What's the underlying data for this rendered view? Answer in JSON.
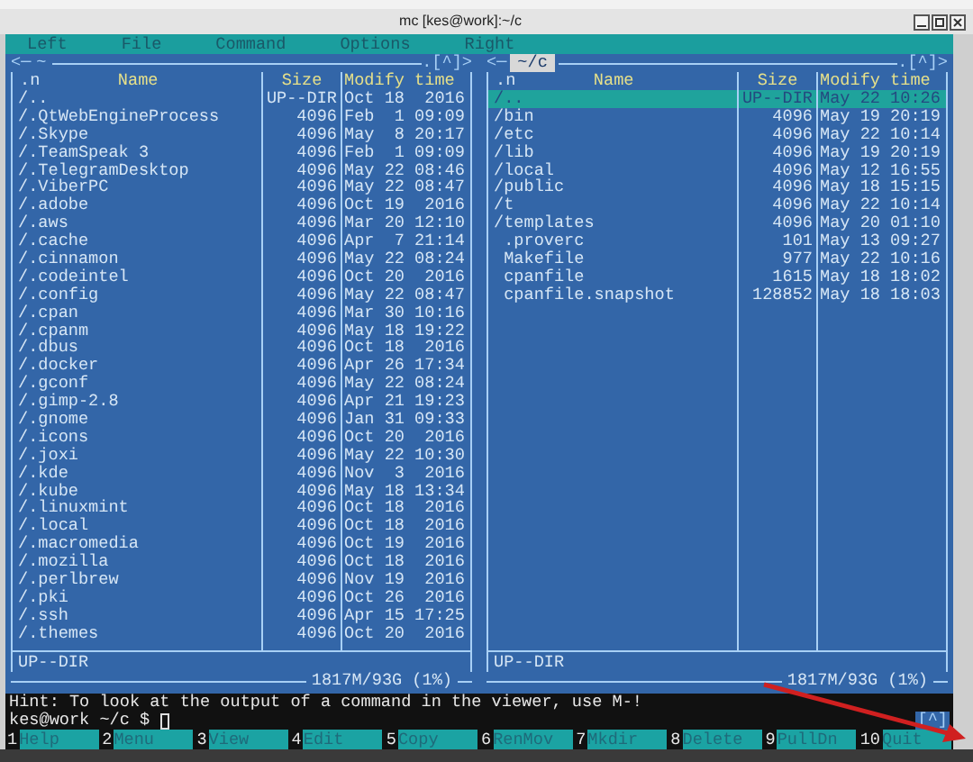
{
  "window": {
    "title": "mc [kes@work]:~/c"
  },
  "menu": [
    "Left",
    "File",
    "Command",
    "Options",
    "Right"
  ],
  "panels": [
    {
      "path": "~",
      "active": false,
      "left_marker": "<─",
      "right_marker": ".[^]>",
      "columns": {
        "sort": ".n",
        "name": "Name",
        "size": "Size",
        "time": "Modify time"
      },
      "files": [
        {
          "name": "/..",
          "size": "UP--DIR",
          "time": "Oct 18  2016",
          "selected": false
        },
        {
          "name": "/.QtWebEngineProcess",
          "size": "4096",
          "time": "Feb  1 09:09",
          "selected": false
        },
        {
          "name": "/.Skype",
          "size": "4096",
          "time": "May  8 20:17",
          "selected": false
        },
        {
          "name": "/.TeamSpeak 3",
          "size": "4096",
          "time": "Feb  1 09:09",
          "selected": false
        },
        {
          "name": "/.TelegramDesktop",
          "size": "4096",
          "time": "May 22 08:46",
          "selected": false
        },
        {
          "name": "/.ViberPC",
          "size": "4096",
          "time": "May 22 08:47",
          "selected": false
        },
        {
          "name": "/.adobe",
          "size": "4096",
          "time": "Oct 19  2016",
          "selected": false
        },
        {
          "name": "/.aws",
          "size": "4096",
          "time": "Mar 20 12:10",
          "selected": false
        },
        {
          "name": "/.cache",
          "size": "4096",
          "time": "Apr  7 21:14",
          "selected": false
        },
        {
          "name": "/.cinnamon",
          "size": "4096",
          "time": "May 22 08:24",
          "selected": false
        },
        {
          "name": "/.codeintel",
          "size": "4096",
          "time": "Oct 20  2016",
          "selected": false
        },
        {
          "name": "/.config",
          "size": "4096",
          "time": "May 22 08:47",
          "selected": false
        },
        {
          "name": "/.cpan",
          "size": "4096",
          "time": "Mar 30 10:16",
          "selected": false
        },
        {
          "name": "/.cpanm",
          "size": "4096",
          "time": "May 18 19:22",
          "selected": false
        },
        {
          "name": "/.dbus",
          "size": "4096",
          "time": "Oct 18  2016",
          "selected": false
        },
        {
          "name": "/.docker",
          "size": "4096",
          "time": "Apr 26 17:34",
          "selected": false
        },
        {
          "name": "/.gconf",
          "size": "4096",
          "time": "May 22 08:24",
          "selected": false
        },
        {
          "name": "/.gimp-2.8",
          "size": "4096",
          "time": "Apr 21 19:23",
          "selected": false
        },
        {
          "name": "/.gnome",
          "size": "4096",
          "time": "Jan 31 09:33",
          "selected": false
        },
        {
          "name": "/.icons",
          "size": "4096",
          "time": "Oct 20  2016",
          "selected": false
        },
        {
          "name": "/.joxi",
          "size": "4096",
          "time": "May 22 10:30",
          "selected": false
        },
        {
          "name": "/.kde",
          "size": "4096",
          "time": "Nov  3  2016",
          "selected": false
        },
        {
          "name": "/.kube",
          "size": "4096",
          "time": "May 18 13:34",
          "selected": false
        },
        {
          "name": "/.linuxmint",
          "size": "4096",
          "time": "Oct 18  2016",
          "selected": false
        },
        {
          "name": "/.local",
          "size": "4096",
          "time": "Oct 18  2016",
          "selected": false
        },
        {
          "name": "/.macromedia",
          "size": "4096",
          "time": "Oct 19  2016",
          "selected": false
        },
        {
          "name": "/.mozilla",
          "size": "4096",
          "time": "Oct 18  2016",
          "selected": false
        },
        {
          "name": "/.perlbrew",
          "size": "4096",
          "time": "Nov 19  2016",
          "selected": false
        },
        {
          "name": "/.pki",
          "size": "4096",
          "time": "Oct 26  2016",
          "selected": false
        },
        {
          "name": "/.ssh",
          "size": "4096",
          "time": "Apr 15 17:25",
          "selected": false
        },
        {
          "name": "/.themes",
          "size": "4096",
          "time": "Oct 20  2016",
          "selected": false
        }
      ],
      "mini_status": "UP--DIR",
      "disk": "1817M/93G (1%)"
    },
    {
      "path": "~/c",
      "active": true,
      "left_marker": "<─",
      "right_marker": ".[^]>",
      "columns": {
        "sort": ".n",
        "name": "Name",
        "size": "Size",
        "time": "Modify time"
      },
      "files": [
        {
          "name": "/..",
          "size": "UP--DIR",
          "time": "May 22 10:26",
          "selected": true
        },
        {
          "name": "/bin",
          "size": "4096",
          "time": "May 19 20:19",
          "selected": false
        },
        {
          "name": "/etc",
          "size": "4096",
          "time": "May 22 10:14",
          "selected": false
        },
        {
          "name": "/lib",
          "size": "4096",
          "time": "May 19 20:19",
          "selected": false
        },
        {
          "name": "/local",
          "size": "4096",
          "time": "May 12 16:55",
          "selected": false
        },
        {
          "name": "/public",
          "size": "4096",
          "time": "May 18 15:15",
          "selected": false
        },
        {
          "name": "/t",
          "size": "4096",
          "time": "May 22 10:14",
          "selected": false
        },
        {
          "name": "/templates",
          "size": "4096",
          "time": "May 20 01:10",
          "selected": false
        },
        {
          "name": " .proverc",
          "size": "101",
          "time": "May 13 09:27",
          "selected": false
        },
        {
          "name": " Makefile",
          "size": "977",
          "time": "May 22 10:16",
          "selected": false
        },
        {
          "name": " cpanfile",
          "size": "1615",
          "time": "May 18 18:02",
          "selected": false
        },
        {
          "name": " cpanfile.snapshot",
          "size": "128852",
          "time": "May 18 18:03",
          "selected": false
        }
      ],
      "mini_status": "UP--DIR",
      "disk": "1817M/93G (1%)"
    }
  ],
  "hint": "Hint: To look at the output of a command in the viewer, use M-!",
  "prompt": "kes@work ~/c $",
  "shell_indicator": "[^]",
  "function_keys": [
    {
      "number": "1",
      "label": "Help"
    },
    {
      "number": "2",
      "label": "Menu"
    },
    {
      "number": "3",
      "label": "View"
    },
    {
      "number": "4",
      "label": "Edit"
    },
    {
      "number": "5",
      "label": "Copy"
    },
    {
      "number": "6",
      "label": "RenMov"
    },
    {
      "number": "7",
      "label": "Mkdir"
    },
    {
      "number": "8",
      "label": "Delete"
    },
    {
      "number": "9",
      "label": "PullDn"
    },
    {
      "number": "10",
      "label": "Quit"
    }
  ]
}
